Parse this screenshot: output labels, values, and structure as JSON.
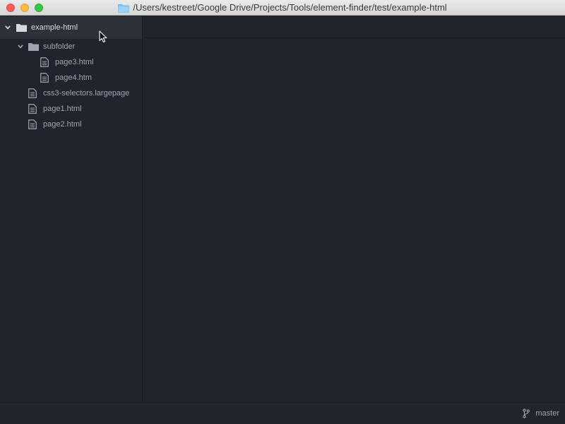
{
  "window": {
    "title": "/Users/kestreet/Google Drive/Projects/Tools/element-finder/test/example-html",
    "title_icon": "folder-icon"
  },
  "colors": {
    "background": "#21252b",
    "selected_row": "#2c313a",
    "text": "#9da5b4",
    "folder_icon": "#9da5b4",
    "title_folder_icon": "#7fc4f4"
  },
  "tree": {
    "root": {
      "label": "example-html",
      "icon": "folder-icon",
      "expanded": true
    },
    "subfolder": {
      "label": "subfolder",
      "icon": "folder-icon",
      "expanded": true
    },
    "files": [
      {
        "label": "page3.html",
        "icon": "file-icon"
      },
      {
        "label": "page4.htm",
        "icon": "file-icon"
      },
      {
        "label": "css3-selectors.largepage",
        "icon": "file-icon"
      },
      {
        "label": "page1.html",
        "icon": "file-icon"
      },
      {
        "label": "page2.html",
        "icon": "file-icon"
      }
    ]
  },
  "statusbar": {
    "branch": "master",
    "branch_icon": "git-branch-icon"
  }
}
